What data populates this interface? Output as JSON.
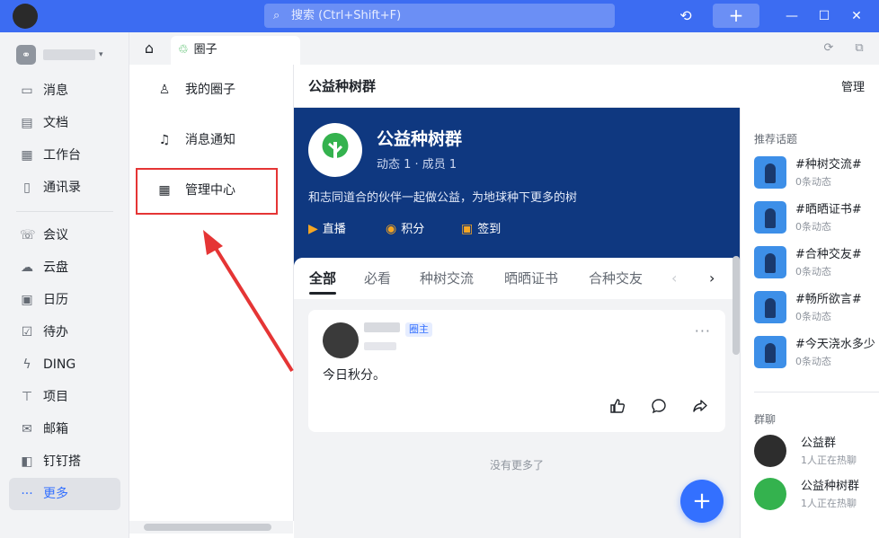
{
  "titlebar": {
    "search_placeholder": "搜索 (Ctrl+Shift+F)",
    "search_icon": "search-icon",
    "history_icon": "history-icon",
    "plus_label": "+",
    "minimize": "—",
    "maximize": "☐",
    "close": "✕"
  },
  "sidebar": {
    "org_caret": "▾",
    "items_top": [
      {
        "icon": "message-icon",
        "glyph": "▭",
        "label": "消息"
      },
      {
        "icon": "document-icon",
        "glyph": "▤",
        "label": "文档"
      },
      {
        "icon": "workbench-icon",
        "glyph": "▦",
        "label": "工作台"
      },
      {
        "icon": "contacts-icon",
        "glyph": "▯",
        "label": "通讯录"
      }
    ],
    "items_bottom": [
      {
        "icon": "meeting-icon",
        "glyph": "☏",
        "label": "会议"
      },
      {
        "icon": "cloud-icon",
        "glyph": "☁",
        "label": "云盘"
      },
      {
        "icon": "calendar-icon",
        "glyph": "▣",
        "label": "日历"
      },
      {
        "icon": "todo-icon",
        "glyph": "☑",
        "label": "待办"
      },
      {
        "icon": "ding-icon",
        "glyph": "ϟ",
        "label": "DING"
      },
      {
        "icon": "project-icon",
        "glyph": "⊤",
        "label": "项目"
      },
      {
        "icon": "mail-icon",
        "glyph": "✉",
        "label": "邮箱"
      },
      {
        "icon": "dingtalk-builder-icon",
        "glyph": "◧",
        "label": "钉钉搭"
      },
      {
        "icon": "more-icon",
        "glyph": "···",
        "label": "更多"
      }
    ]
  },
  "tabs": {
    "home_glyph": "⌂",
    "circle_tab_label": "圈子",
    "circle_tab_glyph": "♲"
  },
  "left_panel": {
    "items": [
      {
        "icon": "person-icon",
        "glyph": "♙",
        "label": "我的圈子"
      },
      {
        "icon": "bell-icon",
        "glyph": "♫",
        "label": "消息通知"
      },
      {
        "icon": "grid-icon",
        "glyph": "▦",
        "label": "管理中心"
      }
    ]
  },
  "main": {
    "header_title": "公益种树群",
    "manage_label": "管理",
    "banner": {
      "name": "公益种树群",
      "stats": "动态 1 · 成员 1",
      "description": "和志同道合的伙伴一起做公益，为地球种下更多的树",
      "actions": [
        {
          "icon": "live-icon",
          "glyph": "▶",
          "label": "直播"
        },
        {
          "icon": "points-icon",
          "glyph": "◉",
          "label": "积分"
        },
        {
          "icon": "checkin-icon",
          "glyph": "▣",
          "label": "签到"
        }
      ]
    },
    "feed_tabs": [
      "全部",
      "必看",
      "种树交流",
      "晒晒证书",
      "合种交友"
    ],
    "feed_prev": "‹",
    "feed_next": "›",
    "post": {
      "badge": "圈主",
      "more": "···",
      "text": "今日秋分。",
      "like_glyph": "👍",
      "comment_glyph": "◯",
      "share_glyph": "➦"
    },
    "no_more": "没有更多了",
    "fab_label": "+"
  },
  "right_panel": {
    "topics_title": "推荐话题",
    "topics": [
      {
        "title": "#种树交流#",
        "count": "0条动态"
      },
      {
        "title": "#晒晒证书#",
        "count": "0条动态"
      },
      {
        "title": "#合种交友#",
        "count": "0条动态"
      },
      {
        "title": "#畅所欲言#",
        "count": "0条动态"
      },
      {
        "title": "#今天浇水多少",
        "count": "0条动态"
      }
    ],
    "groups_title": "群聊",
    "groups": [
      {
        "name": "公益群",
        "sub": "1人正在热聊",
        "color": "#2d2d2d"
      },
      {
        "name": "公益种树群",
        "sub": "1人正在热聊",
        "color": "#34b24e"
      }
    ]
  }
}
